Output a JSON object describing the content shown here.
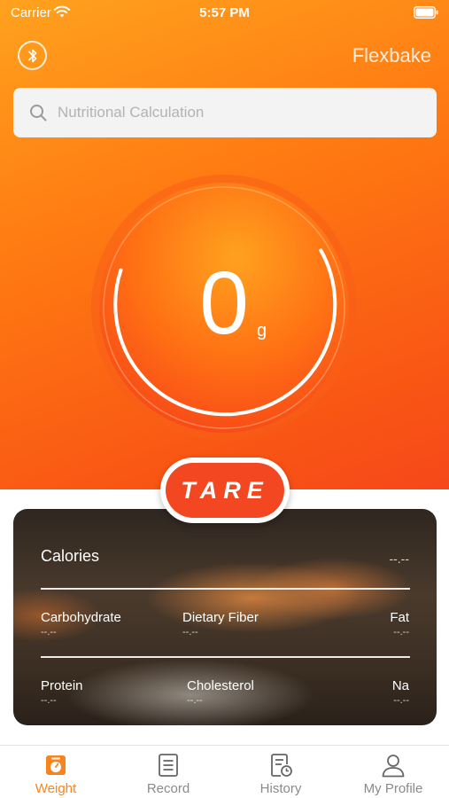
{
  "status_bar": {
    "carrier": "Carrier",
    "time": "5:57 PM"
  },
  "header": {
    "title": "Flexbake",
    "bluetooth_icon": "bluetooth-icon"
  },
  "search": {
    "placeholder": "Nutritional Calculation",
    "value": ""
  },
  "scale": {
    "value": "0",
    "unit": "g"
  },
  "tare": {
    "label": "TARE"
  },
  "nutrition": {
    "calories": {
      "label": "Calories",
      "value": "--.--"
    },
    "row1": [
      {
        "label": "Carbohydrate",
        "value": "--.--"
      },
      {
        "label": "Dietary Fiber",
        "value": "--.--"
      },
      {
        "label": "Fat",
        "value": "--.--"
      }
    ],
    "row2": [
      {
        "label": "Protein",
        "value": "--.--"
      },
      {
        "label": "Cholesterol",
        "value": "--.--"
      },
      {
        "label": "Na",
        "value": "--.--"
      }
    ]
  },
  "tabs": [
    {
      "label": "Weight",
      "icon": "scale-icon",
      "active": true
    },
    {
      "label": "Record",
      "icon": "document-icon",
      "active": false
    },
    {
      "label": "History",
      "icon": "history-icon",
      "active": false
    },
    {
      "label": "My Profile",
      "icon": "profile-icon",
      "active": false
    }
  ],
  "colors": {
    "accent": "#f7841e",
    "tare": "#f34722",
    "hero_top": "#ffa21e",
    "hero_bottom": "#f6481a"
  }
}
